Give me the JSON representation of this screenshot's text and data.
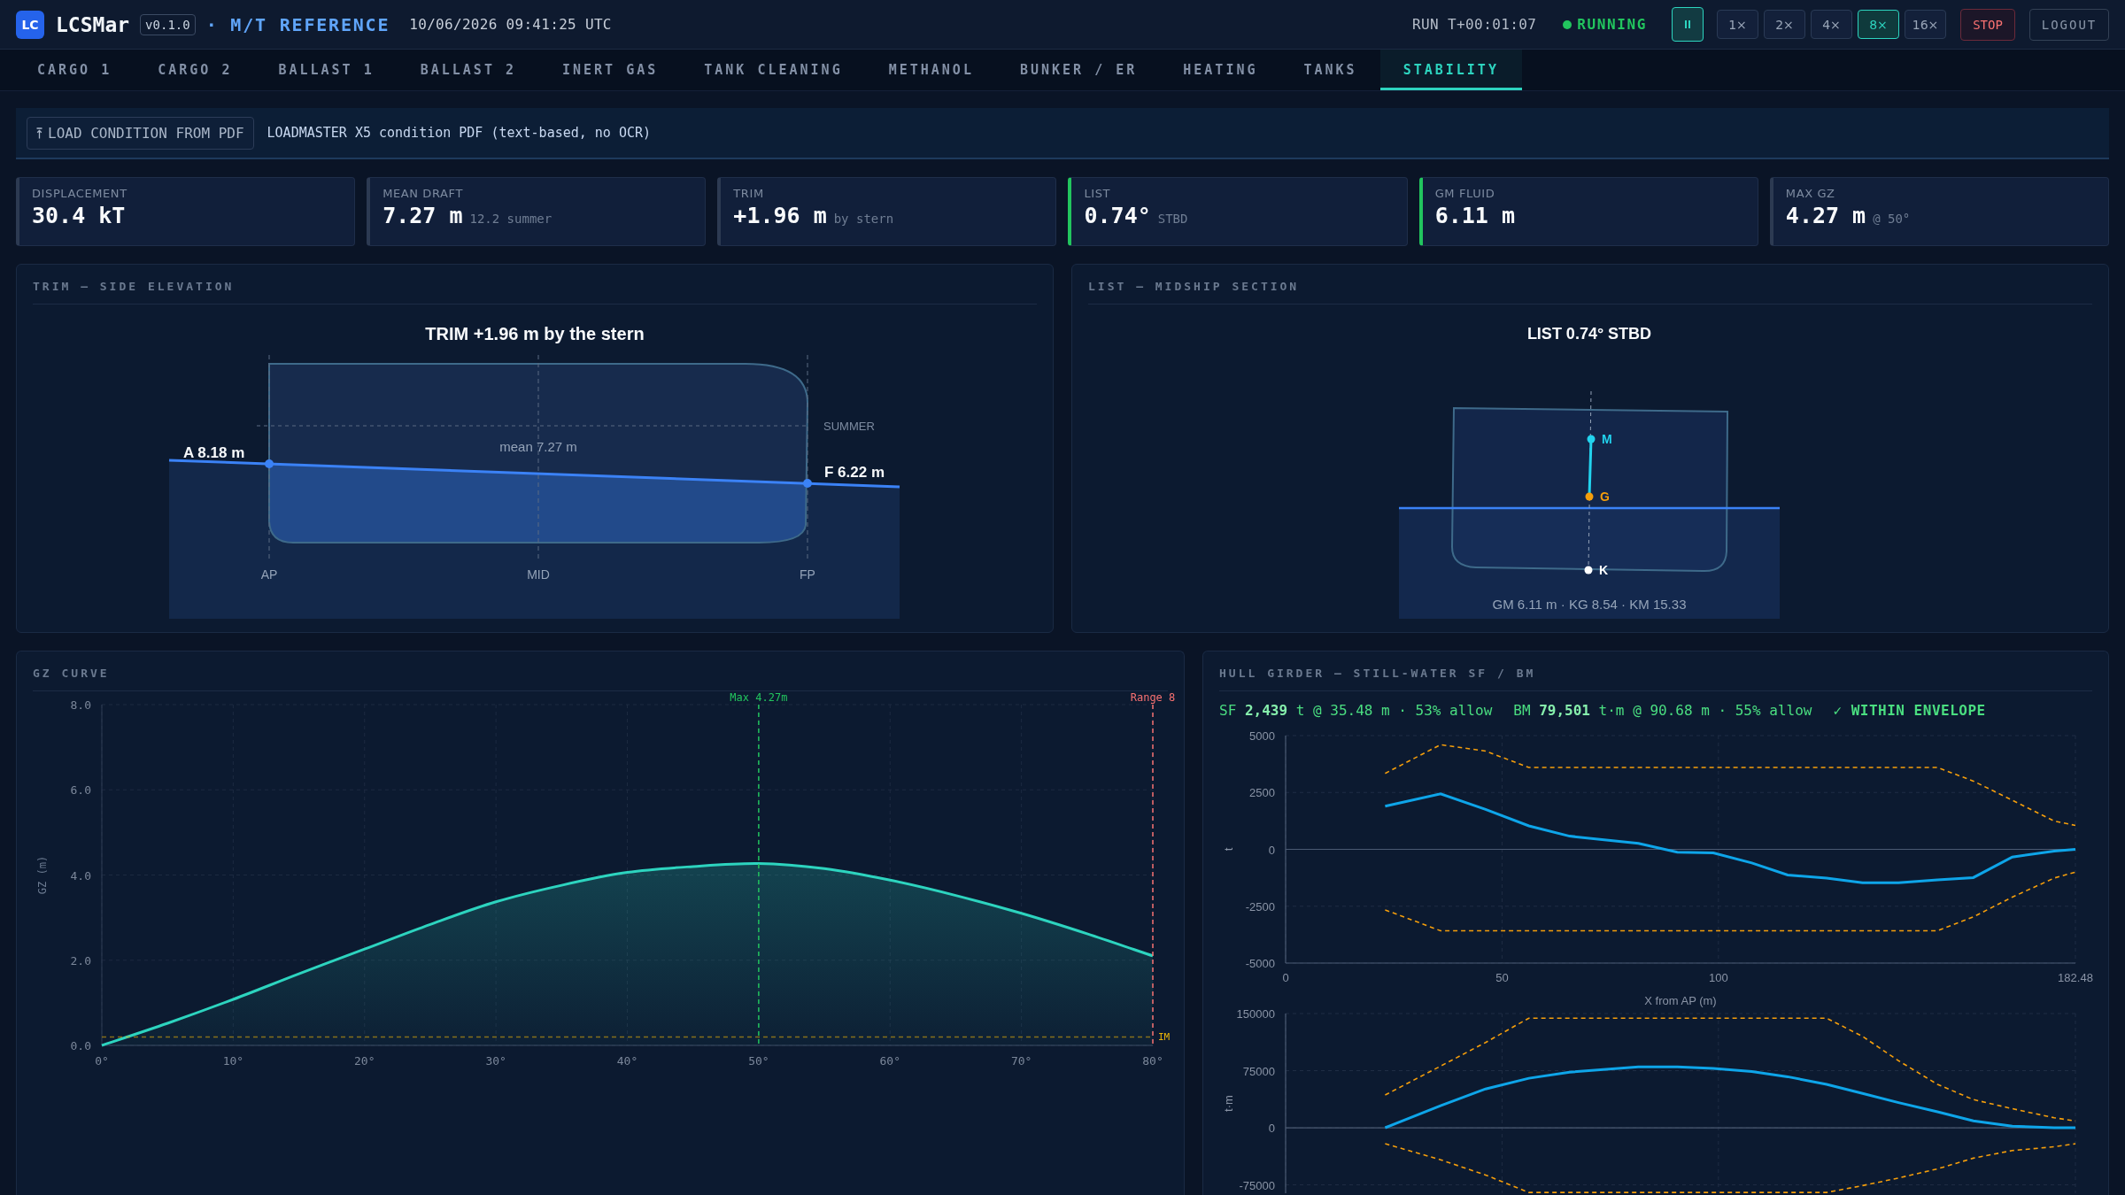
{
  "header": {
    "logo": "LC",
    "app_name": "LCSMar",
    "version": "v0.1.0",
    "vessel": "· M/T REFERENCE",
    "timestamp": "10/06/2026 09:41:25 UTC",
    "run_time": "RUN T+00:01:07",
    "status": "RUNNING",
    "running": true,
    "speeds": [
      {
        "label": "1×",
        "selected": false
      },
      {
        "label": "2×",
        "selected": false
      },
      {
        "label": "4×",
        "selected": false
      },
      {
        "label": "8×",
        "selected": true
      },
      {
        "label": "16×",
        "selected": false
      }
    ],
    "stop": "STOP",
    "logout": "LOGOUT"
  },
  "tabs": [
    {
      "label": "CARGO 1",
      "selected": false
    },
    {
      "label": "CARGO 2",
      "selected": false
    },
    {
      "label": "BALLAST 1",
      "selected": false
    },
    {
      "label": "BALLAST 2",
      "selected": false
    },
    {
      "label": "INERT GAS",
      "selected": false
    },
    {
      "label": "TANK CLEANING",
      "selected": false
    },
    {
      "label": "METHANOL",
      "selected": false
    },
    {
      "label": "BUNKER / ER",
      "selected": false
    },
    {
      "label": "HEATING",
      "selected": false
    },
    {
      "label": "TANKS",
      "selected": false
    },
    {
      "label": "STABILITY",
      "selected": true
    }
  ],
  "load_bar": {
    "button": "LOAD CONDITION FROM PDF",
    "note": "LOADMASTER X5 condition PDF (text-based, no OCR)"
  },
  "cards": [
    {
      "label": "DISPLACEMENT",
      "value": "30.4 kT",
      "ok": false
    },
    {
      "label": "MEAN DRAFT",
      "value": "7.27 m",
      "note": "12.2 summer",
      "ok": false
    },
    {
      "label": "TRIM",
      "value": "+1.96 m",
      "note": "by stern",
      "ok": false
    },
    {
      "label": "LIST",
      "value": "0.74°",
      "note": "STBD",
      "ok": true
    },
    {
      "label": "GM FLUID",
      "value": "6.11 m",
      "ok": true
    },
    {
      "label": "MAX GZ",
      "value": "4.27 m",
      "note": "@ 50°",
      "ok": false
    }
  ],
  "trim_panel": {
    "title": "TRIM — SIDE ELEVATION",
    "heading": "TRIM +1.96 m by the stern",
    "aft_draft": "A 8.18 m",
    "fwd_draft": "F 6.22 m",
    "mean_draft": "mean 7.27 m",
    "load_line": "SUMMER",
    "stations": [
      "AP",
      "MID",
      "FP"
    ]
  },
  "list_panel": {
    "title": "LIST — MIDSHIP SECTION",
    "heading": "LIST 0.74° STBD",
    "points": [
      {
        "label": "M",
        "color": "#22d3ee"
      },
      {
        "label": "G",
        "color": "#f59e0b"
      },
      {
        "label": "K",
        "color": "#ffffff"
      }
    ],
    "summary": "GM 6.11 m · KG 8.54 · KM 15.33"
  },
  "gz_panel": {
    "title": "GZ CURVE",
    "chart_data": {
      "type": "area",
      "ylabel": "GZ (m)",
      "x": [
        0,
        5,
        10,
        15,
        20,
        25,
        30,
        35,
        40,
        45,
        50,
        55,
        60,
        65,
        70,
        75,
        80
      ],
      "series": [
        {
          "color": "#2dd4bf",
          "values": [
            0,
            0.52,
            1.08,
            1.68,
            2.26,
            2.84,
            3.37,
            3.76,
            4.06,
            4.2,
            4.27,
            4.15,
            3.88,
            3.52,
            3.1,
            2.62,
            2.1
          ]
        }
      ],
      "xlim": [
        0,
        80
      ],
      "ylim": [
        0,
        8
      ],
      "xticks": [
        {
          "value": 0,
          "label": "0°"
        },
        {
          "value": 10,
          "label": "10°"
        },
        {
          "value": 20,
          "label": "20°"
        },
        {
          "value": 30,
          "label": "30°"
        },
        {
          "value": 40,
          "label": "40°"
        },
        {
          "value": 50,
          "label": "50°"
        },
        {
          "value": 60,
          "label": "60°"
        },
        {
          "value": 70,
          "label": "70°"
        },
        {
          "value": 80,
          "label": "80°"
        }
      ],
      "yticks": [
        {
          "value": 0,
          "label": "0.0"
        },
        {
          "value": 2,
          "label": "2.0"
        },
        {
          "value": 4,
          "label": "4.0"
        },
        {
          "value": 6,
          "label": "6.0"
        },
        {
          "value": 8,
          "label": "8.0"
        }
      ],
      "grid": true,
      "ref_lines": [
        {
          "axis": "x",
          "value": 50,
          "label": "Max 4.27m",
          "color": "#22c55e",
          "line_style": "dashed"
        },
        {
          "axis": "x",
          "value": 80,
          "label": "Range 8",
          "color": "#f87171",
          "line_style": "dashed"
        },
        {
          "axis": "y",
          "value": 0.2,
          "label": "IM",
          "color": "#eab308",
          "line_style": "dashed"
        }
      ]
    }
  },
  "hull_girder_panel": {
    "title": "HULL GIRDER — STILL-WATER SF / BM",
    "sf_summary": "SF **2,439** t @ 35.48 m · 53% allow",
    "bm_summary": "BM **79,501** t·m @ 90.68 m · 55% allow",
    "verdict": "✓ WITHIN ENVELOPE",
    "within_envelope": true,
    "sf_chart": {
      "chart_data": {
        "type": "line",
        "xlabel": "X from AP (m)",
        "ylabel": "t",
        "x": [
          23.0,
          35.8,
          46.2,
          56.2,
          65.6,
          81.5,
          90.5,
          98.8,
          107.7,
          116.0,
          125.0,
          133.3,
          141.6,
          150.6,
          158.9,
          167.9,
          177.6,
          182.48
        ],
        "series": [
          {
            "color": "#0ea5e9",
            "line_style": "solid",
            "values": [
              1900,
              2440,
              1760,
              1030,
              580,
              260,
              -130,
              -160,
              -600,
              -1130,
              -1260,
              -1470,
              -1470,
              -1340,
              -1240,
              -340,
              -80,
              0
            ]
          },
          {
            "color": "#f59e0b",
            "line_style": "dashed",
            "values": [
              3340,
              4600,
              4320,
              3600,
              3600,
              3600,
              3600,
              3600,
              3600,
              3600,
              3600,
              3600,
              3600,
              3600,
              3000,
              2160,
              1240,
              1050
            ]
          },
          {
            "color": "#f59e0b",
            "line_style": "dashed",
            "values": [
              -2660,
              -3580,
              -3580,
              -3580,
              -3580,
              -3580,
              -3580,
              -3580,
              -3580,
              -3580,
              -3580,
              -3580,
              -3580,
              -3580,
              -2970,
              -2100,
              -1260,
              -1000
            ]
          }
        ],
        "xlim": [
          0,
          182.48
        ],
        "ylim": [
          -5000,
          5000
        ],
        "xticks": [
          0,
          50,
          100,
          182.48
        ],
        "yticks": [
          -5000,
          -2500,
          0,
          2500,
          5000
        ],
        "grid": true
      }
    },
    "bm_chart": {
      "chart_data": {
        "type": "line",
        "ylabel": "t·m",
        "x": [
          23.0,
          35.8,
          46.2,
          56.2,
          65.6,
          81.5,
          90.5,
          98.8,
          107.7,
          116.0,
          125.0,
          133.3,
          141.6,
          150.6,
          158.9,
          167.9,
          177.6,
          182.48
        ],
        "series": [
          {
            "color": "#0ea5e9",
            "line_style": "solid",
            "values": [
              0,
              29000,
              51000,
              65000,
              73000,
              80000,
              80000,
              78000,
              74000,
              67000,
              57000,
              45000,
              33000,
              21000,
              9000,
              2000,
              0,
              0
            ]
          },
          {
            "color": "#f59e0b",
            "line_style": "dashed",
            "values": [
              43000,
              81000,
              112000,
              144000,
              144000,
              144000,
              144000,
              144000,
              144000,
              144000,
              144000,
              120000,
              88000,
              57000,
              37000,
              25000,
              13000,
              9000
            ]
          },
          {
            "color": "#f59e0b",
            "line_style": "dashed",
            "values": [
              -21000,
              -42000,
              -62000,
              -85000,
              -85000,
              -85000,
              -85000,
              -85000,
              -85000,
              -85000,
              -85000,
              -76000,
              -66000,
              -54000,
              -40000,
              -30000,
              -25000,
              -21000
            ]
          }
        ],
        "xlim": [
          0,
          182.48
        ],
        "ylim": [
          -86000,
          150000
        ],
        "yticks": [
          -75000,
          0,
          75000,
          150000
        ],
        "grid": true
      }
    }
  }
}
